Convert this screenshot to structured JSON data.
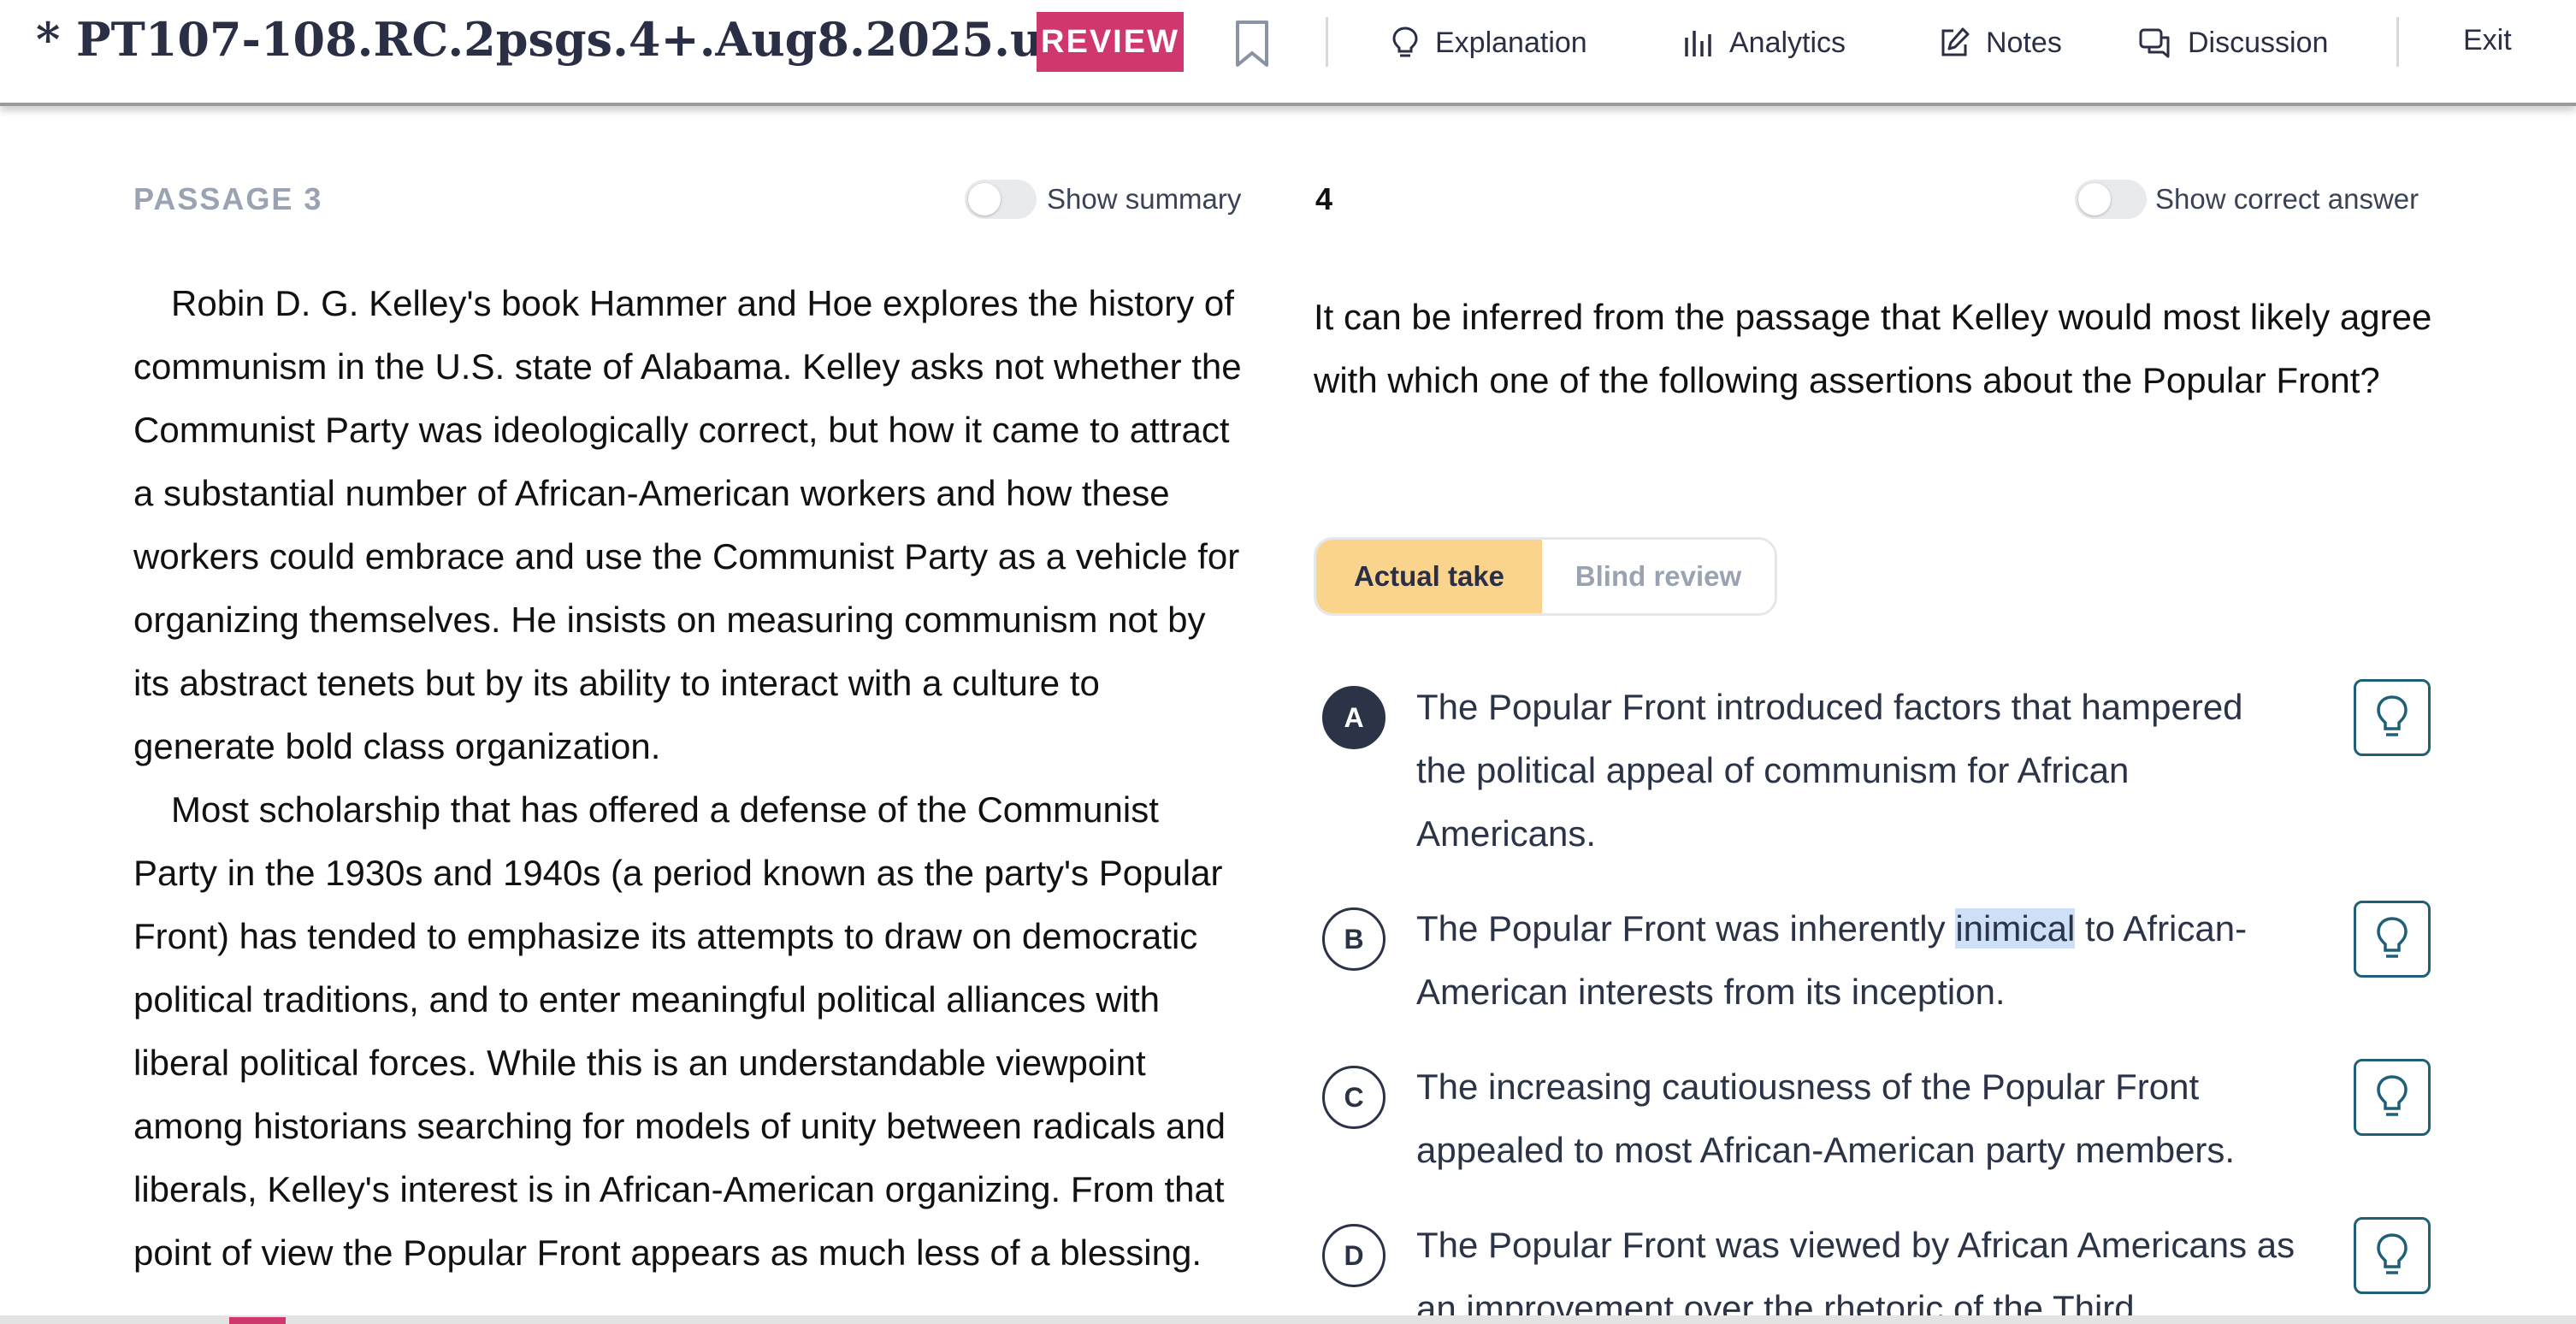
{
  "header": {
    "title": "* PT107-108.RC.2psgs.4+.Aug8.2025.u...",
    "review_label": "REVIEW",
    "nav": [
      {
        "label": "Explanation",
        "icon": "lightbulb-icon"
      },
      {
        "label": "Analytics",
        "icon": "bar-chart-icon"
      },
      {
        "label": "Notes",
        "icon": "edit-icon"
      },
      {
        "label": "Discussion",
        "icon": "chat-bubbles-icon"
      }
    ],
    "exit_label": "Exit"
  },
  "passage": {
    "label": "PASSAGE 3",
    "summary_toggle_label": "Show summary",
    "summary_on": false,
    "paragraphs": [
      "Robin D. G. Kelley's book Hammer and Hoe explores the history of communism in the U.S. state of Alabama. Kelley asks not whether the Communist Party was ideologically correct, but how it came to attract a substantial number of African-American workers and how these workers could embrace and use the Communist Party as a vehicle for organizing themselves. He insists on measuring communism not by its abstract tenets but by its ability to interact with a culture to generate bold class organization.",
      "Most scholarship that has offered a defense of the Communist Party in the 1930s and 1940s (a period known as the party's Popular Front) has tended to emphasize its attempts to draw on democratic political traditions, and to enter meaningful political alliances with liberal political forces. While this is an understandable viewpoint among historians searching for models of unity between radicals and liberals, Kelley's interest is in African-American organizing. From that point of view the Popular Front appears as much less of a blessing."
    ]
  },
  "question": {
    "number": "4",
    "correct_toggle_label": "Show correct answer",
    "correct_on": false,
    "stem": "It can be inferred from the passage that Kelley would most likely agree with which one of the following assertions about the Popular Front?",
    "take_tabs": {
      "active": "Actual take",
      "inactive": "Blind review"
    },
    "choices": [
      {
        "letter": "A",
        "text": "The Popular Front introduced factors that hampered the political appeal of communism for African Americans.",
        "selected": true
      },
      {
        "letter": "B",
        "text_before": "The Popular Front was inherently ",
        "highlight": "inimical",
        "text_after": " to African-American interests from its inception.",
        "selected": false
      },
      {
        "letter": "C",
        "text": "The increasing cautiousness of the Popular Front appealed to most African-American party members.",
        "selected": false
      },
      {
        "letter": "D",
        "text": "The Popular Front was viewed by African Americans as an improvement over the rhetoric of the Third",
        "selected": false
      }
    ]
  },
  "colors": {
    "review_badge": "#d1376f",
    "active_tab": "#fad48d",
    "hint_border": "#1f5f78",
    "highlight": "#cde0f7"
  }
}
